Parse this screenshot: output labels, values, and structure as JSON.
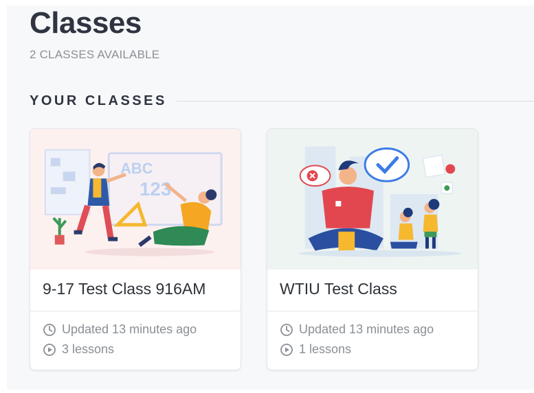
{
  "page": {
    "title": "Classes",
    "subtitle": "2 CLASSES AVAILABLE"
  },
  "section": {
    "title": "YOUR CLASSES"
  },
  "classes": [
    {
      "title": "9-17 Test Class 916AM",
      "updated": "Updated 13 minutes ago",
      "lessons": "3 lessons",
      "illustration": "teacher-classroom-illustration",
      "illustration_text": [
        "ABC",
        "123"
      ],
      "background": "#fdf1f0"
    },
    {
      "title": "WTIU Test Class",
      "updated": "Updated 13 minutes ago",
      "lessons": "1 lessons",
      "illustration": "teacher-students-feedback-illustration",
      "background": "#eef4f2"
    }
  ],
  "icons": {
    "updated": "clock-icon",
    "lessons": "play-circle-icon"
  },
  "colors": {
    "accent_blue": "#3b7be6",
    "accent_red": "#e2474f",
    "accent_yellow": "#f5b82e",
    "text_dark": "#2f3440",
    "text_muted": "#8a8f95"
  }
}
